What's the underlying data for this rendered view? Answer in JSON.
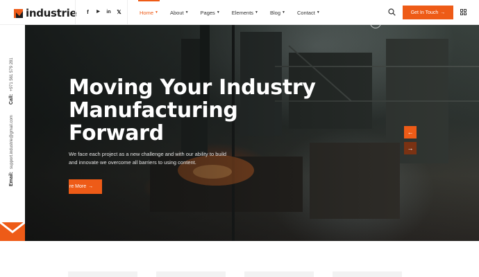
{
  "brand": {
    "name": "industrie",
    "accent": "#ee5b17"
  },
  "socials": [
    {
      "icon": "facebook-icon",
      "glyph": "f"
    },
    {
      "icon": "youtube-icon",
      "glyph": "▶"
    },
    {
      "icon": "linkedin-icon",
      "glyph": "in"
    },
    {
      "icon": "x-icon",
      "glyph": "𝕏"
    }
  ],
  "nav": [
    {
      "label": "Home",
      "active": true
    },
    {
      "label": "About"
    },
    {
      "label": "Pages"
    },
    {
      "label": "Elements"
    },
    {
      "label": "Blog"
    },
    {
      "label": "Contact"
    }
  ],
  "header": {
    "cta_label": "Get In Touch",
    "cta_arrow": "→"
  },
  "rail": {
    "call_label": "Call:",
    "call_value": "+971 561 579 281",
    "email_label": "Email:",
    "email_value": "support.industrie@gmail.com"
  },
  "hero": {
    "title_lines": [
      "Moving Your Industry",
      "Manufacturing",
      "Forward"
    ],
    "description": "We face each project as a new challenge and with our ability to build and innovate we overcome all barriers to using content.",
    "button_label": "re More",
    "button_arrow": "→",
    "prev_glyph": "←",
    "next_glyph": "→"
  }
}
